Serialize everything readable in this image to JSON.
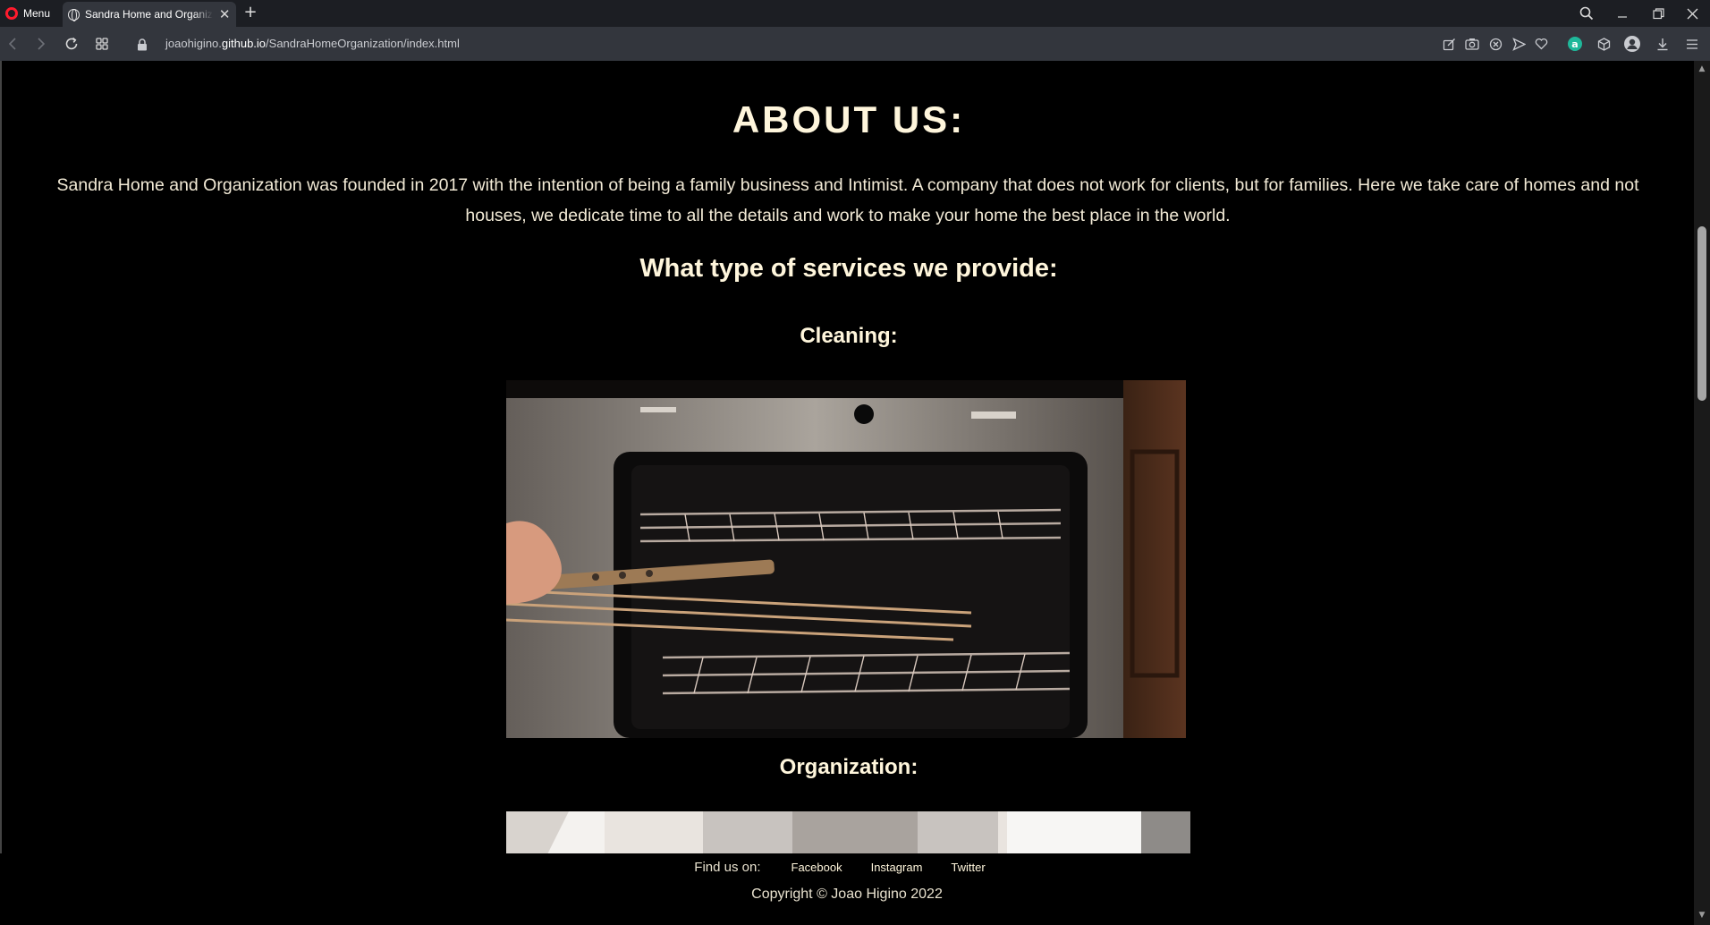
{
  "browser": {
    "menu_label": "Menu",
    "tab_title": "Sandra Home and Organization",
    "tab_close": "✕",
    "new_tab": "+",
    "url_prefix": "joaohigino.",
    "url_domain": "github.io",
    "url_path": "/SandraHomeOrganization/index.html",
    "accent_color": "#ff1b2d"
  },
  "page": {
    "about_title": "ABOUT US:",
    "about_text": "Sandra Home and Organization was founded in 2017 with the intention of being a family business and Intimist. A company that does not work for clients, but for families. Here we take care of homes and not houses, we dedicate time to all the details and work to make your home the best place in the world.",
    "services_title": "What type of services we provide:",
    "services": [
      {
        "title": "Cleaning:",
        "image": "oven-cleaning-photo"
      },
      {
        "title": "Organization:",
        "image": "organization-photo"
      }
    ],
    "text_color": "#fff6dc",
    "background_color": "#000000"
  },
  "footer": {
    "find_label": "Find us on:",
    "links": [
      "Facebook",
      "Instagram",
      "Twitter"
    ],
    "copyright": "Copyright © Joao Higino 2022"
  }
}
